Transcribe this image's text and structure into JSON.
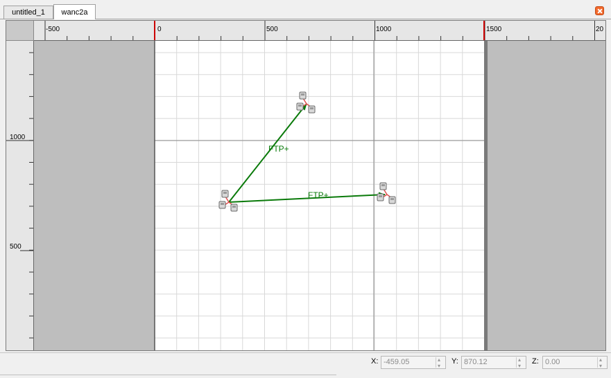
{
  "tabs": [
    {
      "label": "untitled_1"
    },
    {
      "label": "wanc2a"
    }
  ],
  "ruler": {
    "h_labels": [
      "-500",
      "0",
      "500",
      "1000",
      "1500",
      "20"
    ],
    "v_labels": [
      "1000",
      "500"
    ]
  },
  "nodes": [
    {
      "id": "node-top",
      "kind": "network-node-icon"
    },
    {
      "id": "node-source",
      "kind": "network-node-icon"
    },
    {
      "id": "node-right",
      "kind": "network-node-icon"
    }
  ],
  "links": [
    {
      "label": "FTP+",
      "color": "#0a7a0a"
    },
    {
      "label": "FTP+",
      "color": "#0a7a0a"
    }
  ],
  "status": {
    "x_label": "X:",
    "x_value": "-459.05",
    "y_label": "Y:",
    "y_value": "870.12",
    "z_label": "Z:",
    "z_value": "0.00"
  },
  "colors": {
    "boundary": "#cc0000",
    "outside_area": "#bebebe",
    "grid": "#d8d8d8"
  }
}
